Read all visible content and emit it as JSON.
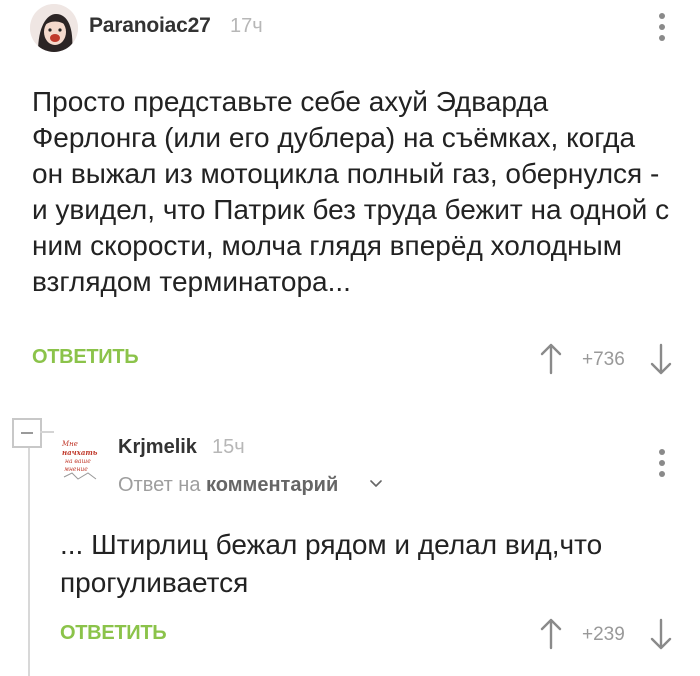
{
  "comments": [
    {
      "author": "Paranoiac27",
      "time": "17ч",
      "text": "Просто представьте себе ахуй Эдварда Ферлонга (или его дублера) на съёмках, когда он выжал из мотоцикла полный газ, обернулся - и увидел, что Патрик  без труда бежит на одной с ним скорости, молча глядя вперёд холодным взглядом терминатора...",
      "reply_label": "ОТВЕТИТЬ",
      "rating": "+736"
    },
    {
      "author": "Krjmelik",
      "time": "15ч",
      "reply_to_prefix": "Ответ на",
      "reply_to_target": "комментарий",
      "text": "... Штирлиц бежал рядом и делал вид,что прогуливается",
      "reply_label": "ОТВЕТИТЬ",
      "rating": "+239"
    }
  ],
  "avatar_text": [
    "Мне",
    "начхать",
    "на ваше",
    "мнение"
  ],
  "colors": {
    "accent": "#8bc34a",
    "text": "#222222",
    "muted": "#b7b7b7",
    "icon": "#8a8a8a"
  },
  "icons": {
    "more": "vertical-dots-icon",
    "upvote": "arrow-up-icon",
    "downvote": "arrow-down-icon",
    "collapse": "minus-box-icon",
    "chevron": "chevron-down-icon"
  }
}
